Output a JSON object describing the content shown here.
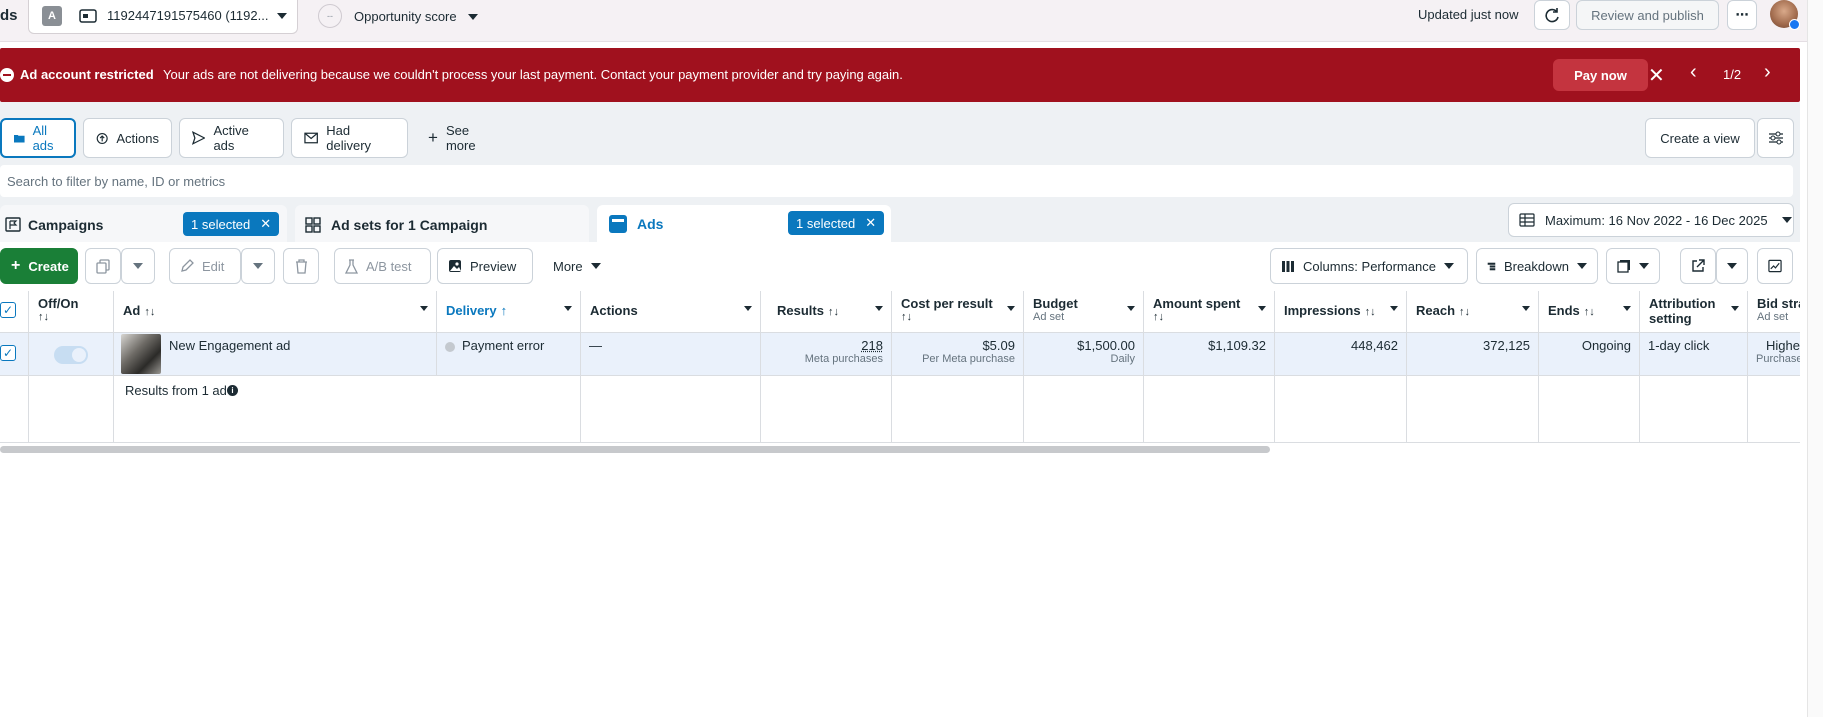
{
  "topbar": {
    "app_title_fragment": "ds",
    "account_badge": "A",
    "account_id": "1192447191575460 (1192...",
    "opportunity_score_dot": "--",
    "opportunity_score_label": "Opportunity score",
    "updated_text": "Updated just now",
    "review_publish_label": "Review and publish",
    "more_icon": "⋯"
  },
  "banner": {
    "title": "Ad account restricted",
    "message": "Your ads are not delivering because we couldn't process your last payment. Contact your payment provider and try paying again.",
    "pay_now_label": "Pay now",
    "pager": "1/2"
  },
  "filter_tabs": [
    {
      "label": "All ads",
      "icon": "folder-icon"
    },
    {
      "label": "Actions",
      "icon": "arrow-up-circle-icon"
    },
    {
      "label": "Active ads",
      "icon": "send-icon"
    },
    {
      "label": "Had delivery",
      "icon": "envelope-icon"
    },
    {
      "label": "See more",
      "icon": "plus-icon"
    }
  ],
  "create_view_label": "Create a view",
  "search": {
    "placeholder": "Search to filter by name, ID or metrics"
  },
  "level_tabs": {
    "campaigns": {
      "label": "Campaigns",
      "chip": "1 selected"
    },
    "adsets": {
      "label": "Ad sets for 1 Campaign"
    },
    "ads": {
      "label": "Ads",
      "chip": "1 selected"
    }
  },
  "date_range": "Maximum: 16 Nov 2022 - 16 Dec 2025",
  "toolbar": {
    "create": "Create",
    "edit": "Edit",
    "ab_test": "A/B test",
    "preview": "Preview",
    "more": "More",
    "columns": "Columns: Performance",
    "breakdown": "Breakdown"
  },
  "table": {
    "headers": {
      "offon": "Off/On",
      "ad": "Ad",
      "delivery": "Delivery",
      "actions": "Actions",
      "results": "Results",
      "cost_per_result": "Cost per result",
      "budget": "Budget",
      "budget_sub": "Ad set",
      "amount_spent": "Amount spent",
      "impressions": "Impressions",
      "reach": "Reach",
      "ends": "Ends",
      "attribution_1": "Attribution",
      "attribution_2": "setting",
      "bid_strategy": "Bid stra",
      "bid_strategy_sub": "Ad set"
    },
    "row": {
      "ad_name": "New Engagement ad",
      "delivery": "Payment error",
      "actions": "—",
      "results": "218",
      "results_sub": "Meta purchases",
      "cost_per_result": "$5.09",
      "cost_sub": "Per Meta purchase",
      "budget": "$1,500.00",
      "budget_sub": "Daily",
      "amount_spent": "$1,109.32",
      "impressions": "448,462",
      "reach": "372,125",
      "ends": "Ongoing",
      "attribution": "1-day click",
      "bid_strategy": "Highe",
      "bid_sub": "Purchase"
    },
    "footer": {
      "label": "Results from 1 ad"
    }
  },
  "colors": {
    "accent": "#0a78be",
    "banner_red": "#a0111e",
    "create_green": "#1a7f37"
  }
}
